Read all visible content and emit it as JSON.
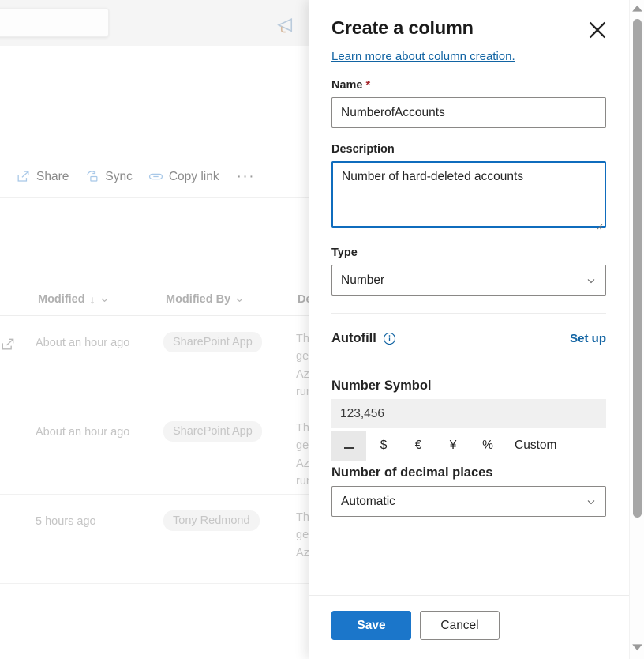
{
  "background": {
    "search": {
      "placeholder": "",
      "value": ""
    },
    "feedback_icon": "megaphone-icon",
    "commandbar": [
      {
        "label": "Share",
        "icon": "share-icon"
      },
      {
        "label": "Sync",
        "icon": "sync-icon"
      },
      {
        "label": "Copy link",
        "icon": "link-icon"
      }
    ],
    "overflow_label": "···",
    "columns": [
      {
        "label": "Modified",
        "sorted": "descending"
      },
      {
        "label": "Modified By"
      },
      {
        "label": "De"
      }
    ],
    "rows": [
      {
        "modified": "About an hour ago",
        "modified_by": "SharePoint App",
        "description": "Thi\nger\nAzu\nrun"
      },
      {
        "modified": "About an hour ago",
        "modified_by": "SharePoint App",
        "description": "Thi\nger\nAzu\nrun"
      },
      {
        "modified": "5 hours ago",
        "modified_by": "Tony Redmond",
        "description": "Thi\nger\nAzu"
      }
    ]
  },
  "panel": {
    "title": "Create a column",
    "close_icon": "close-icon",
    "learn_link": "Learn more about column creation.",
    "name": {
      "label": "Name",
      "required_marker": "*",
      "value": "NumberofAccounts",
      "placeholder": ""
    },
    "description": {
      "label": "Description",
      "value": "Number of hard-deleted accounts",
      "placeholder": ""
    },
    "type": {
      "label": "Type",
      "value": "Number",
      "options": [
        "Number"
      ]
    },
    "autofill": {
      "label": "Autofill",
      "info_icon": "info-icon",
      "action_label": "Set up"
    },
    "number_symbol": {
      "label": "Number Symbol",
      "preview": "123,456",
      "options": [
        {
          "id": "none",
          "label": "_",
          "selected": true
        },
        {
          "id": "dollar",
          "label": "$",
          "selected": false
        },
        {
          "id": "euro",
          "label": "€",
          "selected": false
        },
        {
          "id": "yen",
          "label": "¥",
          "selected": false
        },
        {
          "id": "percent",
          "label": "%",
          "selected": false
        },
        {
          "id": "custom",
          "label": "Custom",
          "selected": false
        }
      ]
    },
    "decimal_places": {
      "label": "Number of decimal places",
      "value": "Automatic",
      "options": [
        "Automatic"
      ]
    },
    "footer": {
      "save_label": "Save",
      "cancel_label": "Cancel"
    }
  },
  "colors": {
    "accent": "#1b76ca",
    "link": "#1264a3",
    "focus_border": "#0f6cbd",
    "required": "#a4262c"
  }
}
